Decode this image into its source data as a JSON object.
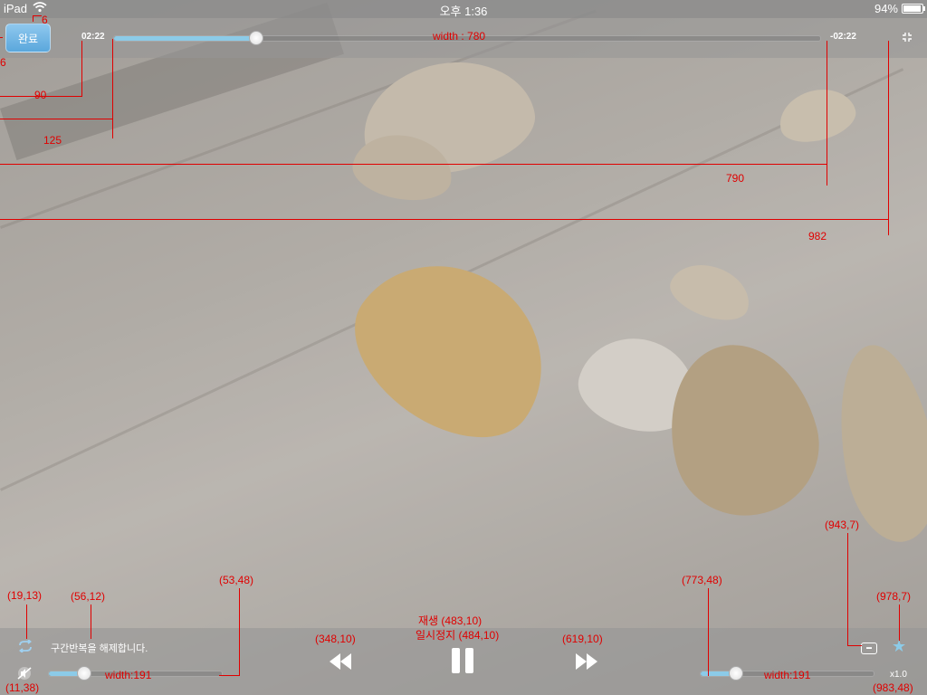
{
  "status_bar": {
    "device": "iPad",
    "time": "오후 1:36",
    "battery": "94%",
    "battery_level": 0.94
  },
  "top_bar": {
    "done_label": "완료",
    "elapsed": "02:22",
    "remaining": "-02:22",
    "progress": 0.2
  },
  "bottom_bar": {
    "repeat_message": "구간반복을 해제합니다.",
    "volume_level": 0.2,
    "speed_level": 0.2,
    "speed_label": "x1.0",
    "caption_icon": "caption-icon",
    "star_icon": "star-icon"
  },
  "annotations": {
    "top_gap": "6",
    "done_left": "6",
    "time_left": "90",
    "seek_left": "125",
    "seek_width": "width : 780",
    "remain_left": "790",
    "fullscreen_left": "982",
    "repeat_pos": "(19,13)",
    "message_pos": "(56,12)",
    "volume_pos": "(53,48)",
    "rew_pos": "(348,10)",
    "play_pos": "재생 (483,10)",
    "pause_pos": "일시정지 (484,10)",
    "ff_pos": "(619,10)",
    "speed_slider_pos": "(773,48)",
    "caption_pos": "(943,7)",
    "star_pos": "(978,7)",
    "vol_icon_pos": "(11,38)",
    "speed_pos": "(983,48)",
    "vol_width": "width:191",
    "speed_width": "width:191"
  }
}
